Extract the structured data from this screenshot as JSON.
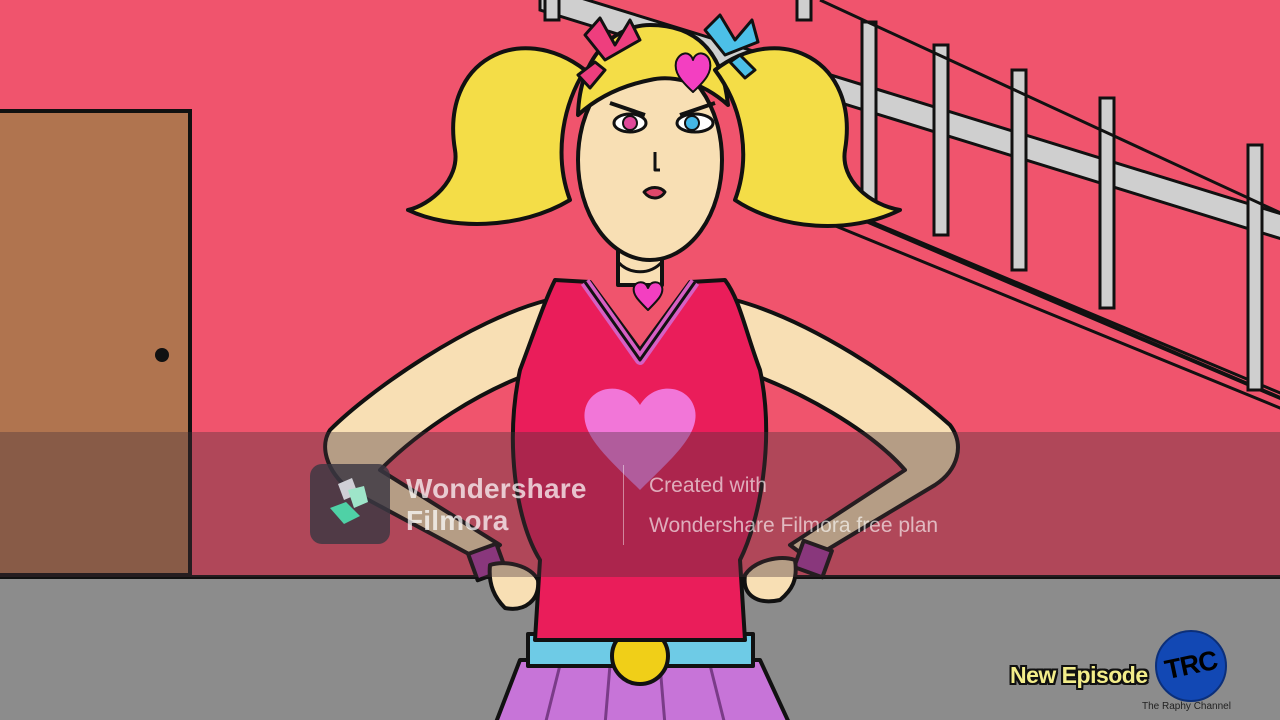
{
  "watermark": {
    "brand_line_1": "Wondershare",
    "brand_line_2": "Filmora",
    "created_line_1": "Created with",
    "created_line_2": "Wondershare Filmora free plan"
  },
  "overlay": {
    "new_episode": "New Episode",
    "logo_text": "TRC",
    "channel_name": "The Raphy Channel"
  },
  "scene": {
    "description_icons": [
      "door",
      "staircase-railing",
      "cartoon-character"
    ]
  },
  "colors": {
    "wall": "#f0546d",
    "floor": "#8c8c8c",
    "door": "#b0744f",
    "hair": "#f4dd47",
    "top": "#ea1d5a",
    "skin": "#f8dfb4",
    "skirt": "#c774d8",
    "belt": "#6ecbe6",
    "buckle": "#f0cf18",
    "logo": "#1248b4",
    "episode_text": "#f3ed8a"
  }
}
